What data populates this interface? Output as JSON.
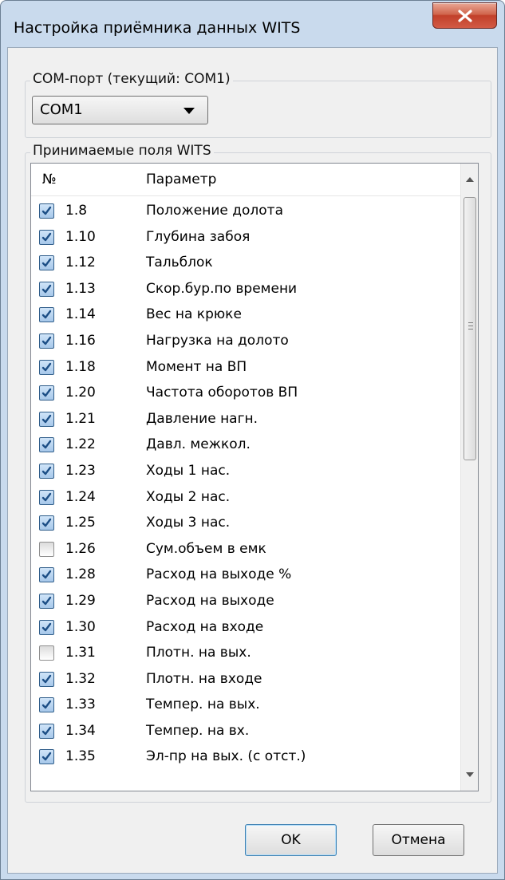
{
  "window": {
    "title": "Настройка приёмника данных WITS",
    "close_icon": "close-x-icon"
  },
  "com_port": {
    "group_label": "COM-порт (текущий: COM1)",
    "selected": "COM1"
  },
  "fields": {
    "group_label": "Принимаемые поля WITS",
    "columns": [
      "№",
      "Параметр"
    ],
    "rows": [
      {
        "num": "1.8",
        "param": "Положение долота",
        "checked": true
      },
      {
        "num": "1.10",
        "param": "Глубина забоя",
        "checked": true
      },
      {
        "num": "1.12",
        "param": "Тальблок",
        "checked": true
      },
      {
        "num": "1.13",
        "param": "Скор.бур.по времени",
        "checked": true
      },
      {
        "num": "1.14",
        "param": "Вес на крюке",
        "checked": true
      },
      {
        "num": "1.16",
        "param": "Нагрузка на долото",
        "checked": true
      },
      {
        "num": "1.18",
        "param": "Момент на ВП",
        "checked": true
      },
      {
        "num": "1.20",
        "param": "Частота оборотов ВП",
        "checked": true
      },
      {
        "num": "1.21",
        "param": "Давление нагн.",
        "checked": true
      },
      {
        "num": "1.22",
        "param": "Давл. межкол.",
        "checked": true
      },
      {
        "num": "1.23",
        "param": "Ходы 1 нас.",
        "checked": true
      },
      {
        "num": "1.24",
        "param": "Ходы 2 нас.",
        "checked": true
      },
      {
        "num": "1.25",
        "param": "Ходы 3 нас.",
        "checked": true
      },
      {
        "num": "1.26",
        "param": "Сум.объем в емк",
        "checked": false
      },
      {
        "num": "1.28",
        "param": "Расход на выходе %",
        "checked": true
      },
      {
        "num": "1.29",
        "param": "Расход на выходе",
        "checked": true
      },
      {
        "num": "1.30",
        "param": "Расход на входе",
        "checked": true
      },
      {
        "num": "1.31",
        "param": "Плотн. на вых.",
        "checked": false
      },
      {
        "num": "1.32",
        "param": "Плотн. на входе",
        "checked": true
      },
      {
        "num": "1.33",
        "param": "Темпер. на вых.",
        "checked": true
      },
      {
        "num": "1.34",
        "param": "Темпер. на вх.",
        "checked": true
      },
      {
        "num": "1.35",
        "param": "Эл-пр на вых. (с отст.)",
        "checked": true
      }
    ]
  },
  "buttons": {
    "ok": "OK",
    "cancel": "Отмена"
  }
}
